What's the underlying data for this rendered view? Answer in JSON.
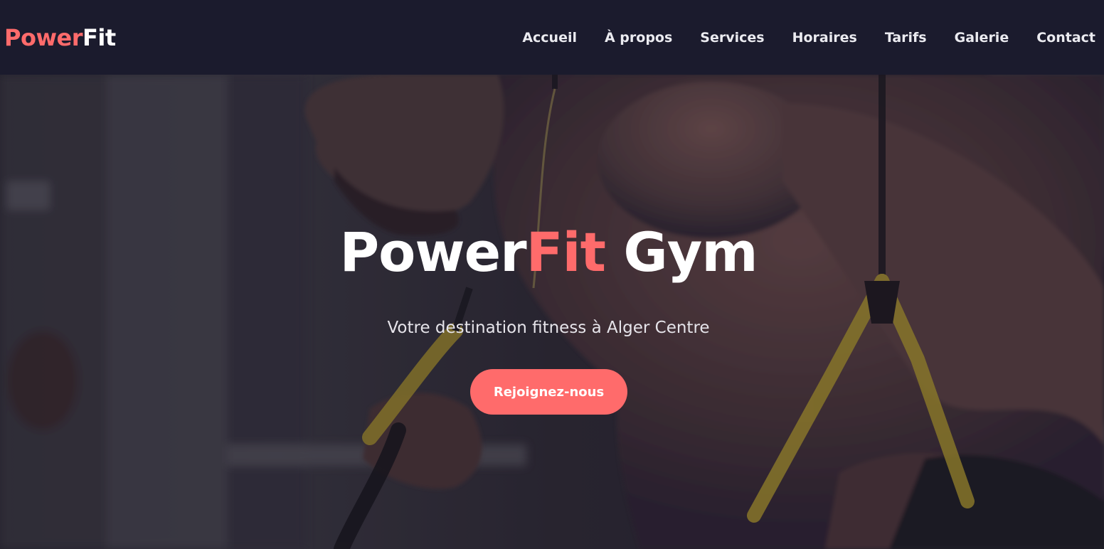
{
  "brand": {
    "logo_part1": "Power",
    "logo_part2": "Fit",
    "accent_color": "#ff6b6b",
    "navbar_color": "#1b1b2d"
  },
  "nav": {
    "items": [
      {
        "label": "Accueil"
      },
      {
        "label": "À propos"
      },
      {
        "label": "Services"
      },
      {
        "label": "Horaires"
      },
      {
        "label": "Tarifs"
      },
      {
        "label": "Galerie"
      },
      {
        "label": "Contact"
      }
    ]
  },
  "hero": {
    "title_part1": "Power",
    "title_part2": "Fit",
    "title_part3": " Gym",
    "subtitle": "Votre destination fitness à Alger Centre",
    "cta_label": "Rejoignez-nous",
    "background_image": "gym-athlete-photo"
  }
}
